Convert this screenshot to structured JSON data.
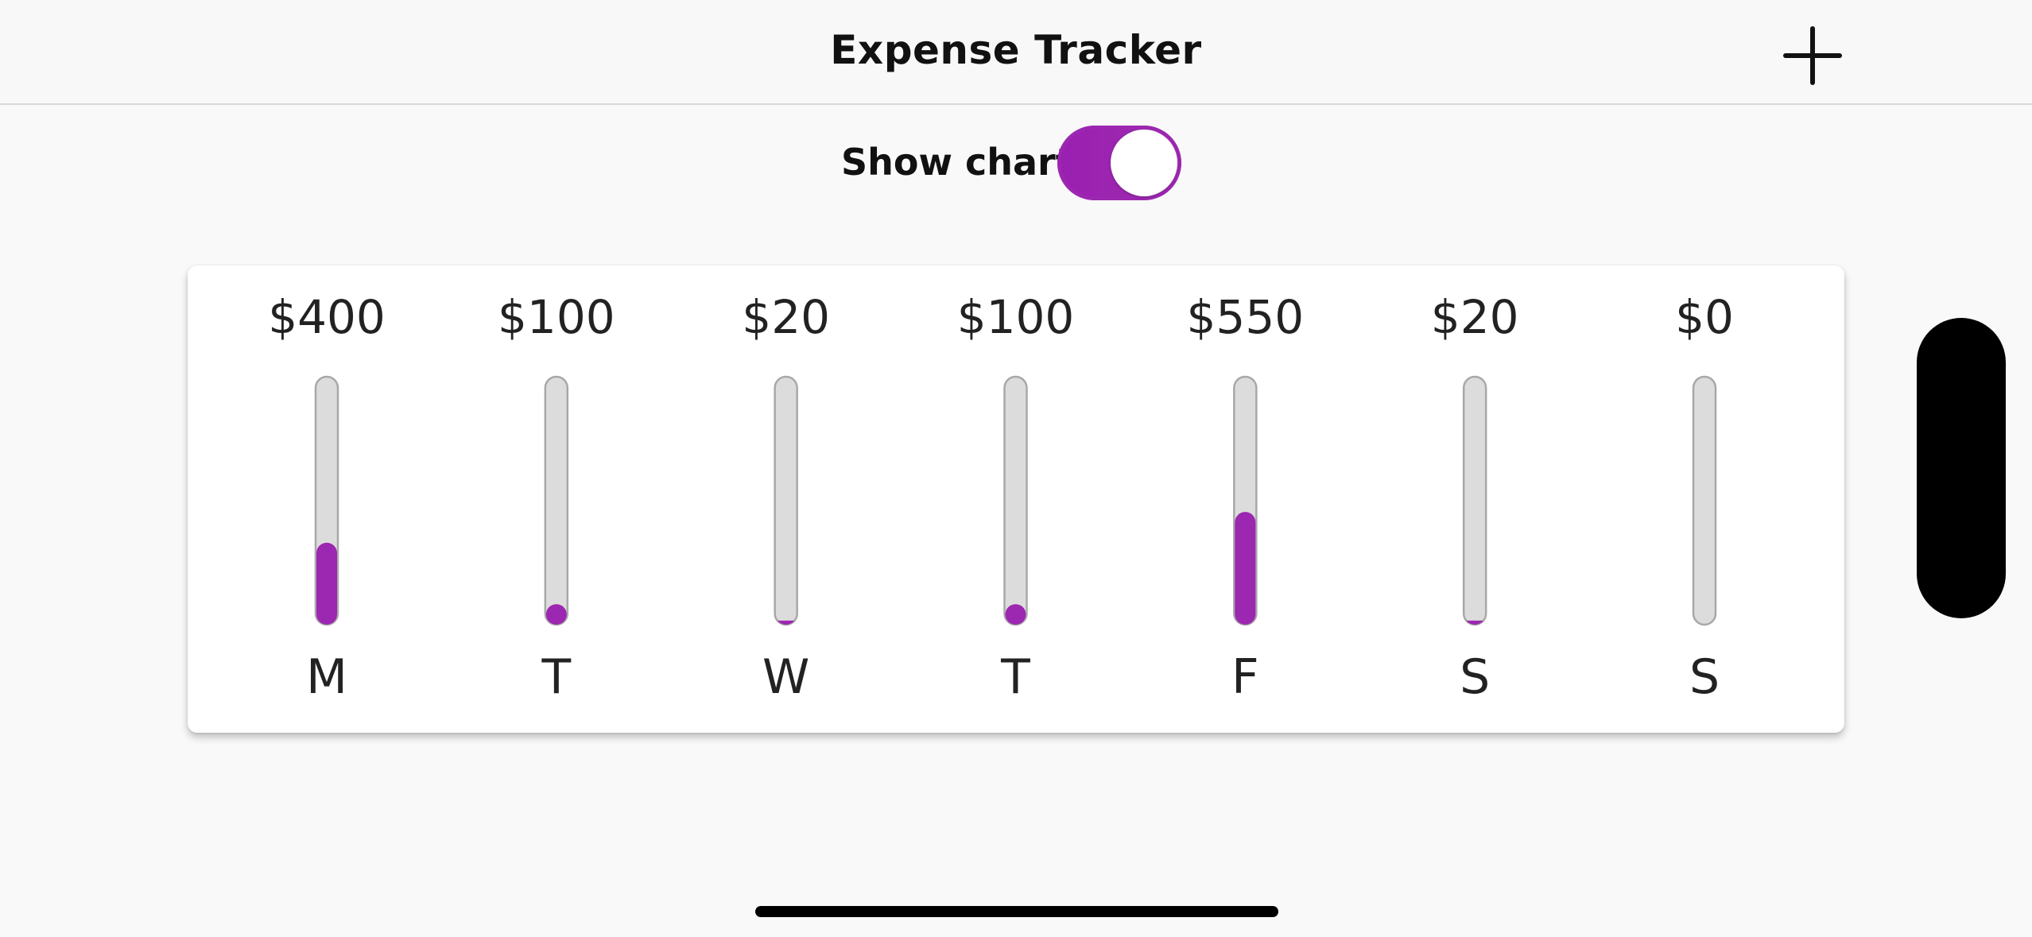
{
  "app_bar": {
    "title": "Expense Tracker",
    "add_icon": "plus-icon"
  },
  "toggle": {
    "label": "Show chart",
    "on": true
  },
  "colors": {
    "accent": "#9c27b0",
    "track_fill": "#dcdcdc",
    "track_border": "#a8a8a8",
    "card": "#ffffff",
    "background": "#f9f9f9"
  },
  "chart_data": {
    "type": "bar",
    "categories": [
      "M",
      "T",
      "W",
      "T",
      "F",
      "S",
      "S"
    ],
    "values": [
      400,
      100,
      20,
      100,
      550,
      20,
      0
    ],
    "value_labels": [
      "$400",
      "$100",
      "$20",
      "$100",
      "$550",
      "$20",
      "$0"
    ],
    "ylim": [
      0,
      1210
    ],
    "grid": false,
    "title": "",
    "xlabel": "",
    "ylabel": ""
  }
}
